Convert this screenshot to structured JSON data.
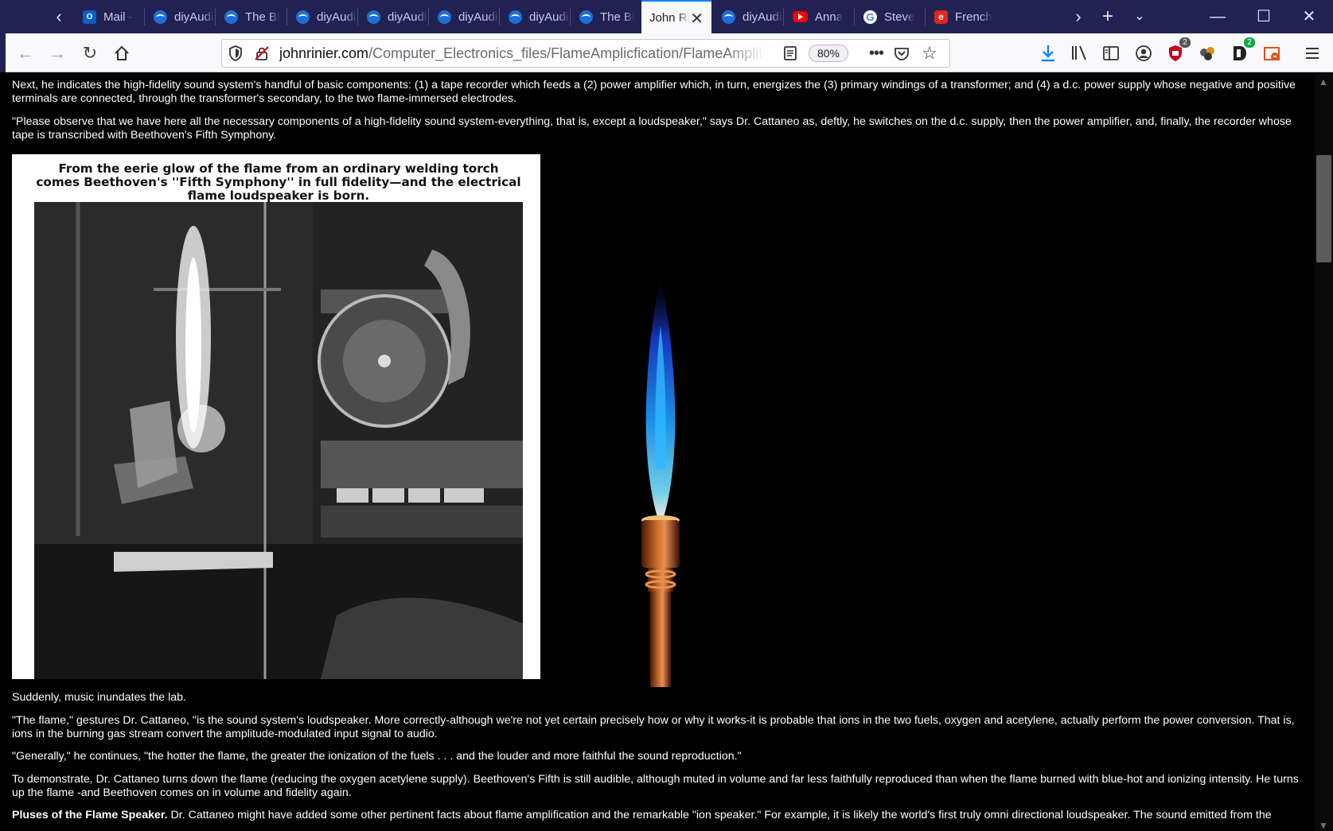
{
  "browser": {
    "tabs": [
      {
        "label": "Mail -",
        "icon": "outlook-icon",
        "kind": "mail"
      },
      {
        "label": "diyAudio",
        "icon": "diyaudio-icon",
        "kind": "diy"
      },
      {
        "label": "The Bl",
        "icon": "diyaudio-icon",
        "kind": "diy"
      },
      {
        "label": "diyAudio",
        "icon": "diyaudio-icon",
        "kind": "diy"
      },
      {
        "label": "diyAudio",
        "icon": "diyaudio-icon",
        "kind": "diy"
      },
      {
        "label": "diyAudio",
        "icon": "diyaudio-icon",
        "kind": "diy"
      },
      {
        "label": "diyAudio",
        "icon": "diyaudio-icon",
        "kind": "diy"
      },
      {
        "label": "The Bl",
        "icon": "diyaudio-icon",
        "kind": "diy"
      },
      {
        "label": "John Ri",
        "icon": "",
        "kind": "active"
      },
      {
        "label": "diyAudio",
        "icon": "diyaudio-icon",
        "kind": "diy"
      },
      {
        "label": "Anna",
        "icon": "youtube-icon",
        "kind": "yt"
      },
      {
        "label": "Steve",
        "icon": "google-icon",
        "kind": "g"
      },
      {
        "label": "French",
        "icon": "french-icon",
        "kind": "fr"
      }
    ],
    "url_host": "johnrinier.com",
    "url_path": "/Computer_Electronics_files/FlameAmplicfication/FlameAmplification",
    "zoom": "80%",
    "badges": {
      "ublock": "2",
      "dashlane": "2"
    },
    "colors": {
      "chrome": "#212253",
      "accent": "#0a84ff",
      "toolbar": "#f9f9fb"
    }
  },
  "page": {
    "para1": "Next, he indicates the high-fidelity sound system's handful of basic components: (1) a tape recorder which feeds a (2) power amplifier which, in turn, energizes the (3) primary windings of a transformer; and (4) a d.c. power supply whose negative and positive terminals are connected, through the transformer's secondary, to the two flame-immersed electrodes.",
    "para2": "\"Please observe that we have here all the necessary components of a high-fidelity sound system-everything, that is, except a loudspeaker,\" says Dr. Cattaneo as, deftly, he switches on the d.c. supply, then the power amplifier, and, finally, the recorder whose tape is transcribed with Beethoven's Fifth Symphony.",
    "photo_caption": "From the eerie glow of the flame from an ordinary welding torch comes Beethoven's ''Fifth Symphony'' in full fidelity—and the electrical flame loudspeaker is born.",
    "para3": "Suddenly, music inundates the lab.",
    "para4": "\"The flame,\" gestures Dr. Cattaneo, \"is the sound system's loudspeaker. More correctly-although we're not yet certain precisely how or why it works-it is probable that ions in the two fuels, oxygen and acetylene, actually perform the power conversion. That is, ions in the burning gas stream convert the amplitude-modulated input signal to audio.",
    "para5": "\"Generally,\" he continues, \"the hotter the flame, the greater the ionization of the fuels . . . and the louder and more faithful the sound reproduction.\"",
    "para6": "To demonstrate, Dr. Cattaneo turns down the flame (reducing the oxygen acetylene supply). Beethoven's Fifth is still audible, although muted in volume and far less faithfully reproduced than when the flame burned with blue-hot and ionizing intensity. He turns up the flame -and Beethoven comes on in volume and fidelity again.",
    "para7_bold": "Pluses of the Flame Speaker.",
    "para7_rest": " Dr. Cattaneo might have added some other pertinent facts about flame amplification and the remarkable \"ion speaker.\" For example, it is likely the world's first truly omni directional loudspeaker. The sound emitted from the"
  }
}
